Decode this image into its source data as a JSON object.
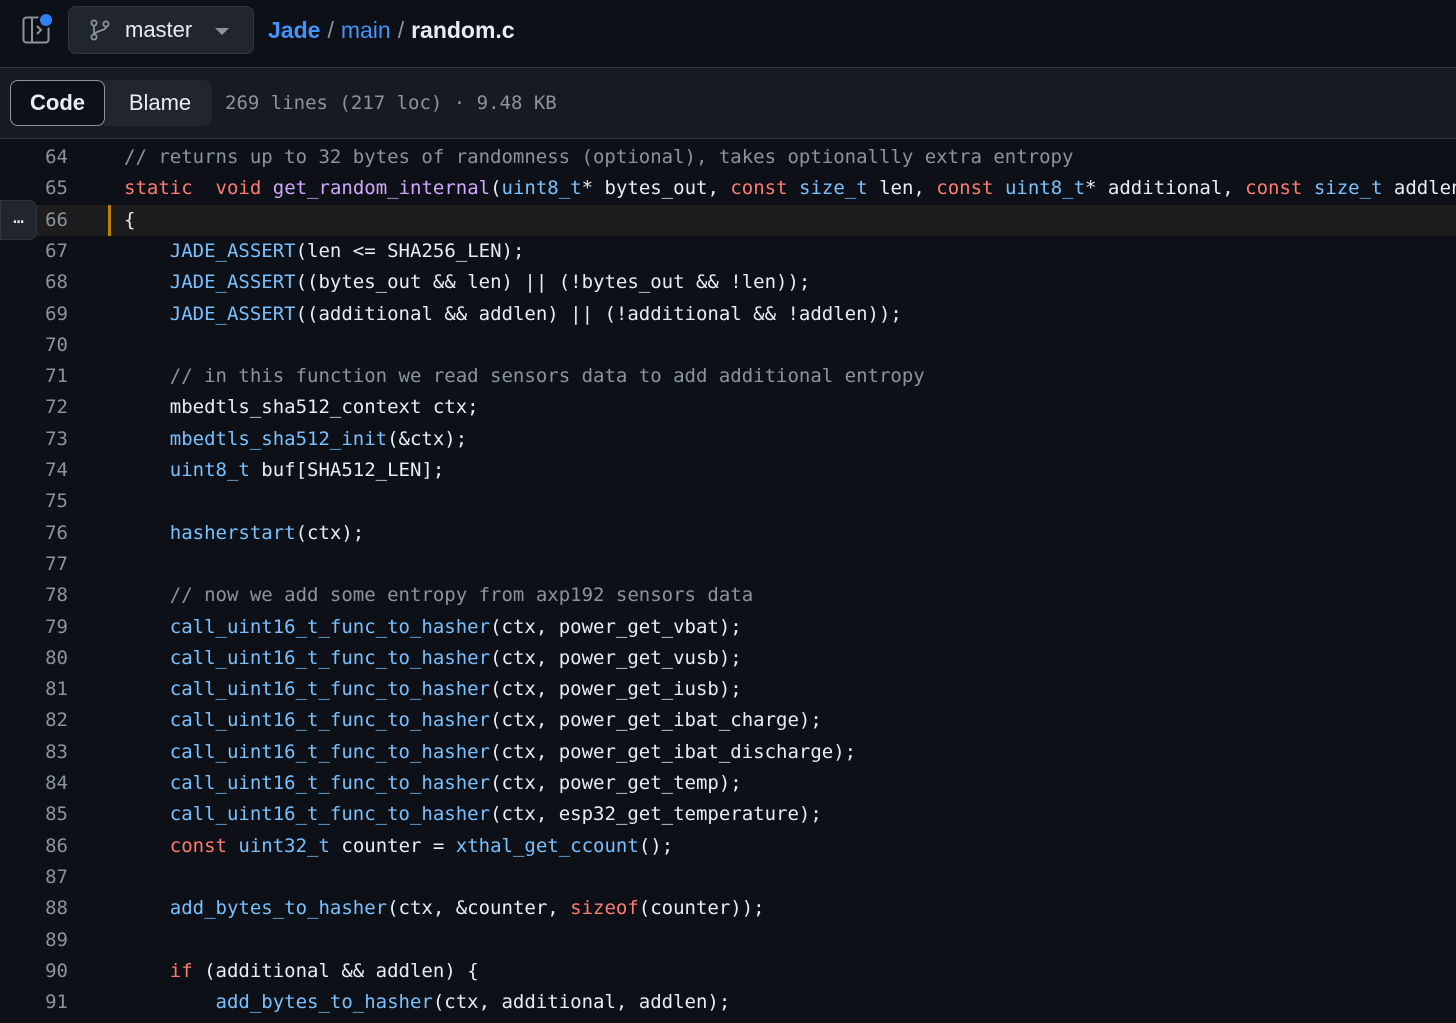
{
  "header": {
    "branch": "master",
    "breadcrumb": [
      {
        "label": "Jade",
        "type": "repo"
      },
      {
        "label": "main",
        "type": "folder"
      },
      {
        "label": "random.c",
        "type": "file"
      }
    ],
    "separator": "/"
  },
  "tabs": {
    "code": "Code",
    "blame": "Blame",
    "file_info": "269 lines (217 loc) · 9.48 KB"
  },
  "expand_button": "…",
  "colors": {
    "keyword": "#ff7b72",
    "type": "#79c0ff",
    "function": "#d2a8ff",
    "comment": "#8b949e",
    "link": "#4493f8",
    "highlight_marker": "#bb8009"
  },
  "icons": [
    "panel-toggle-icon",
    "git-branch-icon",
    "chevron-down-icon"
  ],
  "code_lines": [
    {
      "n": "64",
      "tokens": [
        [
          "cm",
          "// returns up to 32 bytes of randomness (optional), takes optionallly extra entropy"
        ]
      ]
    },
    {
      "n": "65",
      "tokens": [
        [
          "kw",
          "static"
        ],
        [
          "",
          "  "
        ],
        [
          "kw",
          "void"
        ],
        [
          "",
          " "
        ],
        [
          "fn",
          "get_random_internal"
        ],
        [
          "",
          "("
        ],
        [
          "ty",
          "uint8_t"
        ],
        [
          "",
          "* bytes_out, "
        ],
        [
          "kw",
          "const"
        ],
        [
          "",
          " "
        ],
        [
          "ty",
          "size_t"
        ],
        [
          "",
          " len, "
        ],
        [
          "kw",
          "const"
        ],
        [
          "",
          " "
        ],
        [
          "ty",
          "uint8_t"
        ],
        [
          "",
          "* additional, "
        ],
        [
          "kw",
          "const"
        ],
        [
          "",
          " "
        ],
        [
          "ty",
          "size_t"
        ],
        [
          "",
          " addlen)"
        ]
      ]
    },
    {
      "n": "66",
      "tokens": [
        [
          "",
          "{"
        ]
      ],
      "highlight": true
    },
    {
      "n": "67",
      "tokens": [
        [
          "",
          "    "
        ],
        [
          "ty",
          "JADE_ASSERT"
        ],
        [
          "",
          "(len <= SHA256_LEN);"
        ]
      ]
    },
    {
      "n": "68",
      "tokens": [
        [
          "",
          "    "
        ],
        [
          "ty",
          "JADE_ASSERT"
        ],
        [
          "",
          "((bytes_out && len) || (!bytes_out && !len));"
        ]
      ]
    },
    {
      "n": "69",
      "tokens": [
        [
          "",
          "    "
        ],
        [
          "ty",
          "JADE_ASSERT"
        ],
        [
          "",
          "((additional && addlen) || (!additional && !addlen));"
        ]
      ]
    },
    {
      "n": "70",
      "tokens": []
    },
    {
      "n": "71",
      "tokens": [
        [
          "",
          "    "
        ],
        [
          "cm",
          "// in this function we read sensors data to add additional entropy"
        ]
      ]
    },
    {
      "n": "72",
      "tokens": [
        [
          "",
          "    mbedtls_sha512_context ctx;"
        ]
      ]
    },
    {
      "n": "73",
      "tokens": [
        [
          "",
          "    "
        ],
        [
          "ty",
          "mbedtls_sha512_init"
        ],
        [
          "",
          "(&ctx);"
        ]
      ]
    },
    {
      "n": "74",
      "tokens": [
        [
          "",
          "    "
        ],
        [
          "ty",
          "uint8_t"
        ],
        [
          "",
          " buf[SHA512_LEN];"
        ]
      ]
    },
    {
      "n": "75",
      "tokens": []
    },
    {
      "n": "76",
      "tokens": [
        [
          "",
          "    "
        ],
        [
          "ty",
          "hasherstart"
        ],
        [
          "",
          "(ctx);"
        ]
      ]
    },
    {
      "n": "77",
      "tokens": []
    },
    {
      "n": "78",
      "tokens": [
        [
          "",
          "    "
        ],
        [
          "cm",
          "// now we add some entropy from axp192 sensors data"
        ]
      ]
    },
    {
      "n": "79",
      "tokens": [
        [
          "",
          "    "
        ],
        [
          "ty",
          "call_uint16_t_func_to_hasher"
        ],
        [
          "",
          "(ctx, power_get_vbat);"
        ]
      ]
    },
    {
      "n": "80",
      "tokens": [
        [
          "",
          "    "
        ],
        [
          "ty",
          "call_uint16_t_func_to_hasher"
        ],
        [
          "",
          "(ctx, power_get_vusb);"
        ]
      ]
    },
    {
      "n": "81",
      "tokens": [
        [
          "",
          "    "
        ],
        [
          "ty",
          "call_uint16_t_func_to_hasher"
        ],
        [
          "",
          "(ctx, power_get_iusb);"
        ]
      ]
    },
    {
      "n": "82",
      "tokens": [
        [
          "",
          "    "
        ],
        [
          "ty",
          "call_uint16_t_func_to_hasher"
        ],
        [
          "",
          "(ctx, power_get_ibat_charge);"
        ]
      ]
    },
    {
      "n": "83",
      "tokens": [
        [
          "",
          "    "
        ],
        [
          "ty",
          "call_uint16_t_func_to_hasher"
        ],
        [
          "",
          "(ctx, power_get_ibat_discharge);"
        ]
      ]
    },
    {
      "n": "84",
      "tokens": [
        [
          "",
          "    "
        ],
        [
          "ty",
          "call_uint16_t_func_to_hasher"
        ],
        [
          "",
          "(ctx, power_get_temp);"
        ]
      ]
    },
    {
      "n": "85",
      "tokens": [
        [
          "",
          "    "
        ],
        [
          "ty",
          "call_uint16_t_func_to_hasher"
        ],
        [
          "",
          "(ctx, esp32_get_temperature);"
        ]
      ]
    },
    {
      "n": "86",
      "tokens": [
        [
          "",
          "    "
        ],
        [
          "kw",
          "const"
        ],
        [
          "",
          " "
        ],
        [
          "ty",
          "uint32_t"
        ],
        [
          "",
          " counter = "
        ],
        [
          "ty",
          "xthal_get_ccount"
        ],
        [
          "",
          "();"
        ]
      ]
    },
    {
      "n": "87",
      "tokens": []
    },
    {
      "n": "88",
      "tokens": [
        [
          "",
          "    "
        ],
        [
          "ty",
          "add_bytes_to_hasher"
        ],
        [
          "",
          "(ctx, &counter, "
        ],
        [
          "kw",
          "sizeof"
        ],
        [
          "",
          "(counter));"
        ]
      ]
    },
    {
      "n": "89",
      "tokens": []
    },
    {
      "n": "90",
      "tokens": [
        [
          "",
          "    "
        ],
        [
          "kw",
          "if"
        ],
        [
          "",
          " (additional && addlen) {"
        ]
      ]
    },
    {
      "n": "91",
      "tokens": [
        [
          "",
          "        "
        ],
        [
          "ty",
          "add_bytes_to_hasher"
        ],
        [
          "",
          "(ctx, additional, addlen);"
        ]
      ]
    }
  ]
}
